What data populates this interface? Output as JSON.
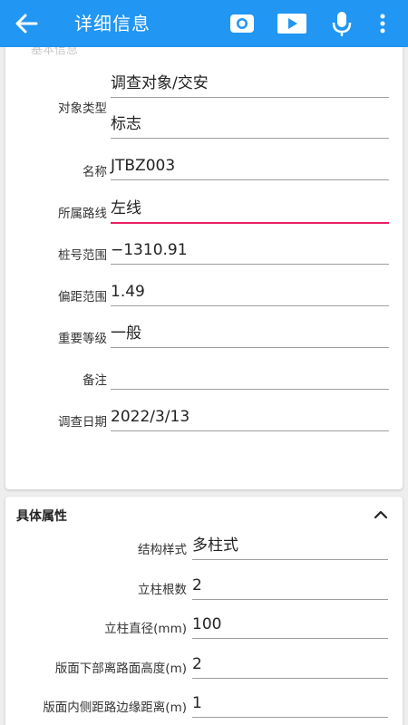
{
  "appbar": {
    "title": "详细信息",
    "back_icon": "arrow-left-icon",
    "camera_icon": "camera-icon",
    "video_icon": "video-icon",
    "mic_icon": "microphone-icon",
    "more_icon": "more-vertical-icon",
    "color": "#2196f3"
  },
  "card1": {
    "faded_text": "基本信息",
    "object_type_label": "对象类型",
    "object_type_value1": "调查对象/交安",
    "object_type_value2": "标志",
    "name_label": "名称",
    "name_value": "JTBZ003",
    "route_label": "所属路线",
    "route_value": "左线",
    "stake_label": "桩号范围",
    "stake_value": "−1310.91",
    "offset_label": "偏距范围",
    "offset_value": "1.49",
    "level_label": "重要等级",
    "level_value": "一般",
    "note_label": "备注",
    "note_value": "",
    "date_label": "调查日期",
    "date_value": "2022/3/13"
  },
  "card2": {
    "title": "具体属性",
    "collapse_icon": "chevron-up-icon",
    "struct_label": "结构样式",
    "struct_value": "多柱式",
    "pillars_label": "立柱根数",
    "pillars_value": "2",
    "diameter_label": "立柱直径(mm)",
    "diameter_value": "100",
    "height_label": "版面下部离路面高度(m)",
    "height_value": "2",
    "edge_label": "版面内侧距路边缘距离(m)",
    "edge_value": "1"
  },
  "colors": {
    "focus_underline": "#e91e63",
    "underline": "#9e9e9e"
  }
}
